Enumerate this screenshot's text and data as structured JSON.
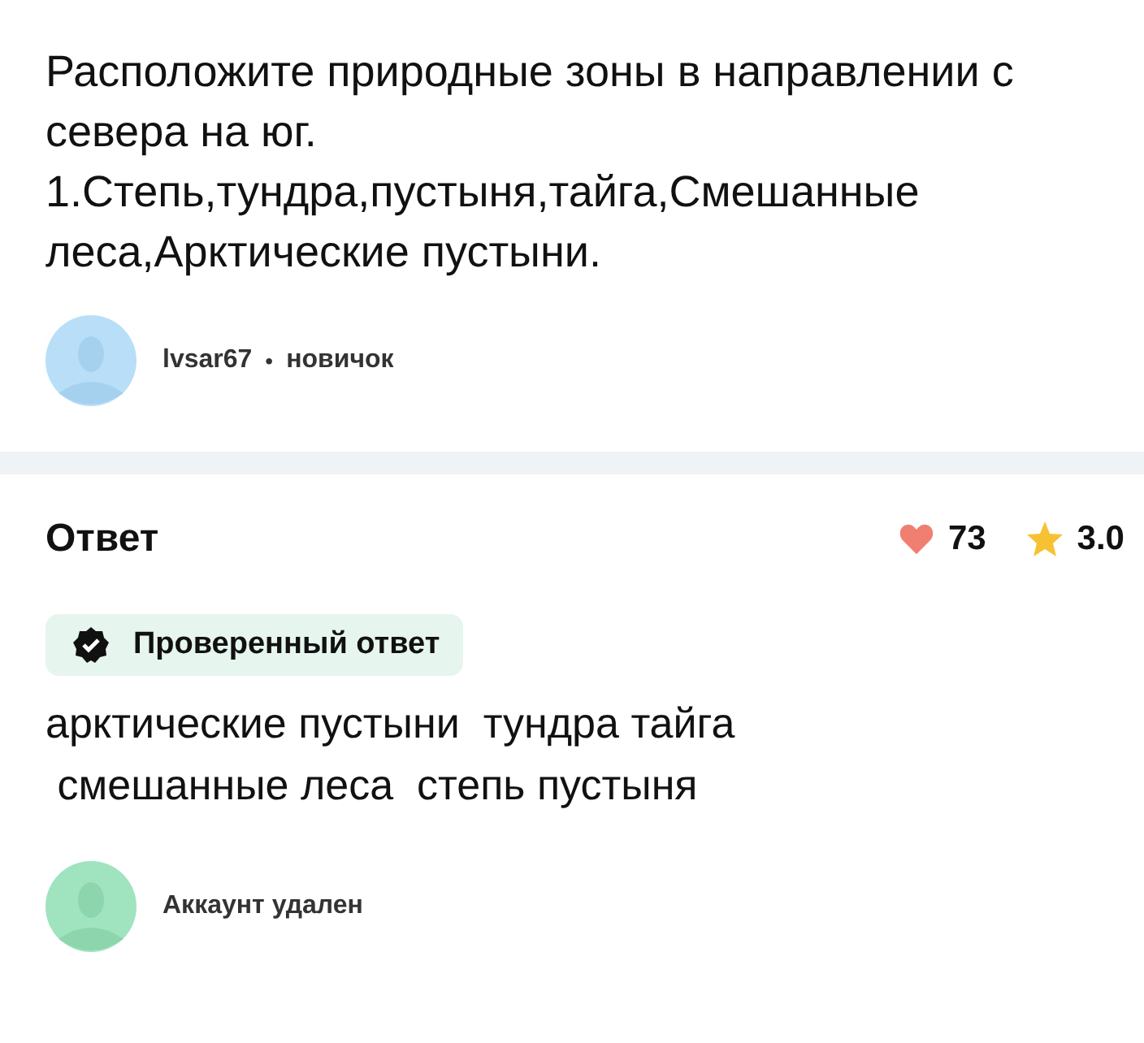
{
  "question": {
    "text": "Расположите природные зоны в направлении с севера на юг. 1.Степь,тундра,пустыня,тайга,Смешанные леса,Арктические пустыни.",
    "author": "lvsar67",
    "separator": "•",
    "rank": "новичок"
  },
  "answer": {
    "heading": "Ответ",
    "likes": "73",
    "rating": "3.0",
    "badge": "Проверенный ответ",
    "text": "арктические пустыни  тундра тайга\n смешанные леса  степь пустыня",
    "author": "Аккаунт удален"
  }
}
